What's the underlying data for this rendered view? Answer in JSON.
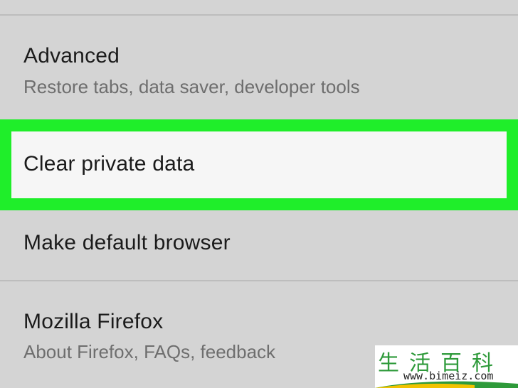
{
  "settings": {
    "items": [
      {
        "title": "Advanced",
        "subtitle": "Restore tabs, data saver, developer tools"
      },
      {
        "title": "Clear private data",
        "subtitle": ""
      },
      {
        "title": "Make default browser",
        "subtitle": ""
      },
      {
        "title": "Mozilla Firefox",
        "subtitle": "About Firefox, FAQs, feedback"
      }
    ]
  },
  "watermark": {
    "chars": "生活百科",
    "url": "www.bimeiz.com"
  },
  "colors": {
    "background": "#d4d4d4",
    "highlight": "#1fee2a",
    "selected_row": "#f6f6f6",
    "watermark_green": "#2e9a3a",
    "watermark_yellow": "#f2c200"
  }
}
